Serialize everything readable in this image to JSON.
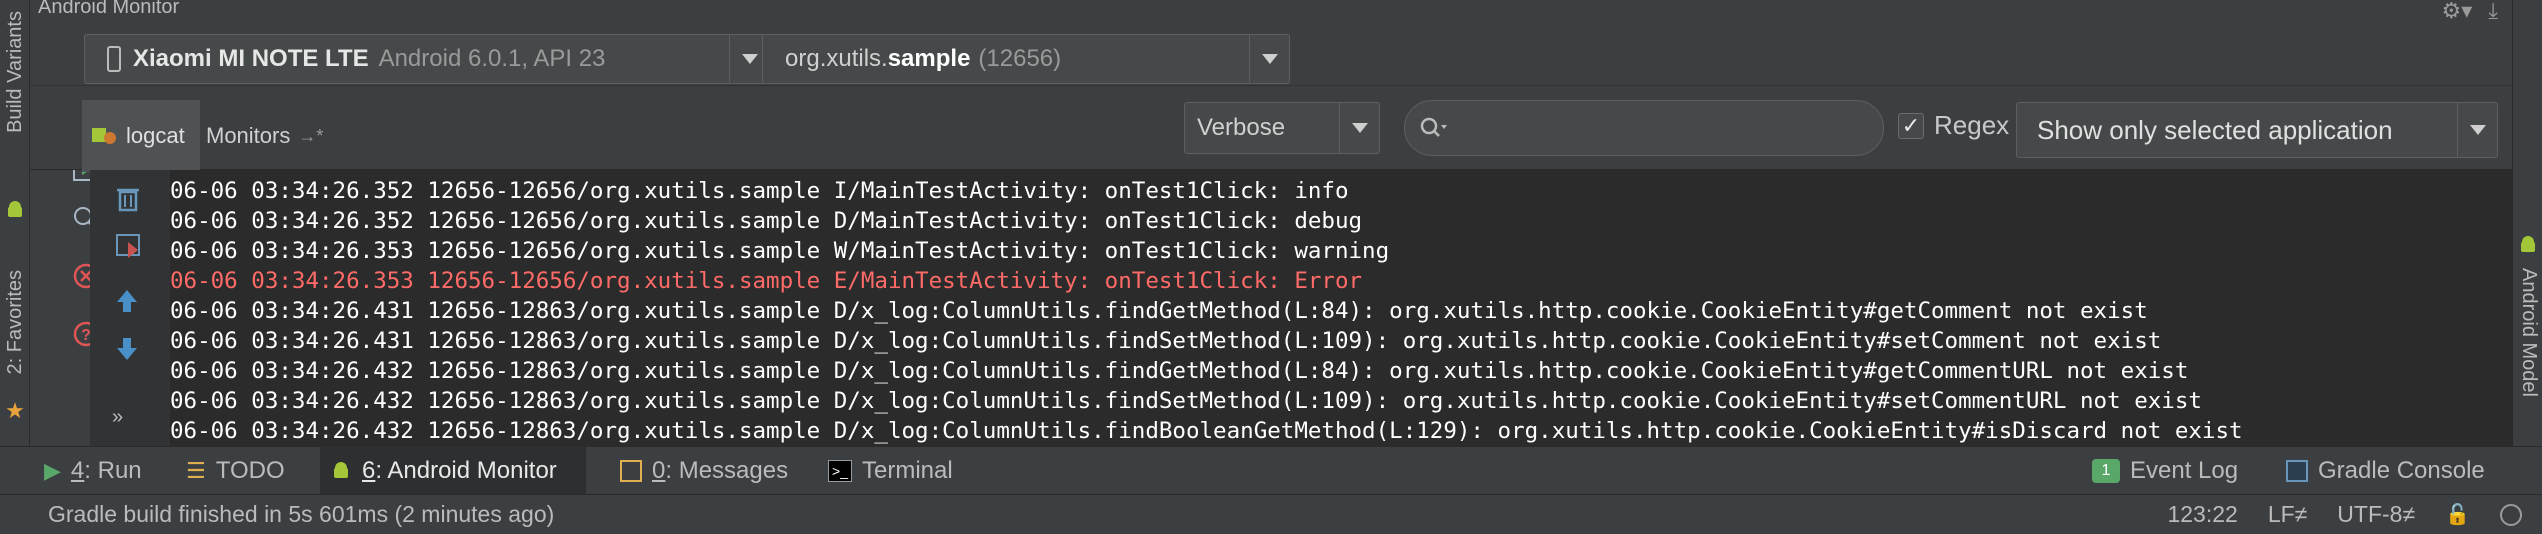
{
  "window": {
    "title": "Android Monitor"
  },
  "left_tabs": {
    "build_variants": "Build Variants",
    "favorites": "2: Favorites"
  },
  "right_tabs": {
    "android_model": "Android Model"
  },
  "device_selector": {
    "device_name": "Xiaomi MI NOTE LTE",
    "device_os": "Android 6.0.1, API 23"
  },
  "app_selector": {
    "prefix": "org.xutils.",
    "bold": "sample",
    "pid": "(12656)"
  },
  "tabs": {
    "logcat": "logcat",
    "monitors": "Monitors"
  },
  "log_level": {
    "selected": "Verbose"
  },
  "search": {
    "value": "",
    "placeholder": ""
  },
  "regex": {
    "label": "Regex",
    "checked": true
  },
  "filter": {
    "selected": "Show only selected application"
  },
  "log_lines": [
    {
      "text": "06-06 03:34:26.352 12656-12656/org.xutils.sample I/MainTestActivity: onTest1Click: info",
      "level": "info"
    },
    {
      "text": "06-06 03:34:26.352 12656-12656/org.xutils.sample D/MainTestActivity: onTest1Click: debug",
      "level": "debug"
    },
    {
      "text": "06-06 03:34:26.353 12656-12656/org.xutils.sample W/MainTestActivity: onTest1Click: warning",
      "level": "warning"
    },
    {
      "text": "06-06 03:34:26.353 12656-12656/org.xutils.sample E/MainTestActivity: onTest1Click: Error",
      "level": "error"
    },
    {
      "text": "06-06 03:34:26.431 12656-12863/org.xutils.sample D/x_log:ColumnUtils.findGetMethod(L:84): org.xutils.http.cookie.CookieEntity#getComment not exist",
      "level": "debug"
    },
    {
      "text": "06-06 03:34:26.431 12656-12863/org.xutils.sample D/x_log:ColumnUtils.findSetMethod(L:109): org.xutils.http.cookie.CookieEntity#setComment not exist",
      "level": "debug"
    },
    {
      "text": "06-06 03:34:26.432 12656-12863/org.xutils.sample D/x_log:ColumnUtils.findGetMethod(L:84): org.xutils.http.cookie.CookieEntity#getCommentURL not exist",
      "level": "debug"
    },
    {
      "text": "06-06 03:34:26.432 12656-12863/org.xutils.sample D/x_log:ColumnUtils.findSetMethod(L:109): org.xutils.http.cookie.CookieEntity#setCommentURL not exist",
      "level": "debug"
    },
    {
      "text": "06-06 03:34:26.432 12656-12863/org.xutils.sample D/x_log:ColumnUtils.findBooleanGetMethod(L:129): org.xutils.http.cookie.CookieEntity#isDiscard not exist",
      "level": "debug"
    }
  ],
  "bottom_tabs": {
    "run": {
      "mnemonic": "4",
      "label": ": Run"
    },
    "todo": {
      "label": "TODO"
    },
    "android_monitor": {
      "mnemonic": "6",
      "label": ": Android Monitor"
    },
    "messages": {
      "mnemonic": "0",
      "label": ": Messages"
    },
    "terminal": {
      "label": "Terminal"
    },
    "event_log": {
      "label": "Event Log",
      "badge": "1"
    },
    "gradle_console": {
      "label": "Gradle Console"
    }
  },
  "status": {
    "message": "Gradle build finished in 5s 601ms (2 minutes ago)",
    "position": "123:22",
    "line_separator": "LF≠",
    "encoding": "UTF-8≠"
  },
  "colors": {
    "error": "#ff6b68",
    "log_text": "#ffffff",
    "log_bg": "#2b2b2b",
    "panel_bg": "#3c3f41"
  }
}
